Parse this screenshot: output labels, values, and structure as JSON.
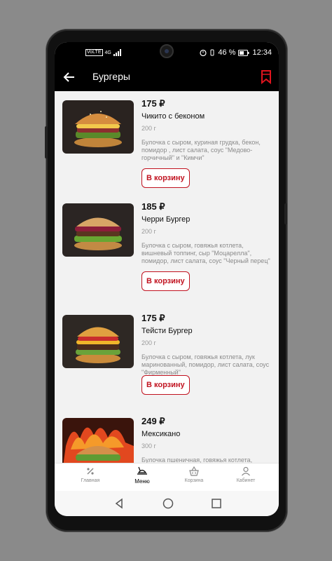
{
  "status_bar": {
    "network_badge": "VoLTE",
    "network_type": "4G",
    "battery_percent": "46 %",
    "time": "12:34"
  },
  "app_bar": {
    "title": "Бургеры",
    "back_icon": "arrow-left-icon",
    "bookmark_icon": "bookmark-icon"
  },
  "products": [
    {
      "price": "175 ₽",
      "name": "Чикито с беконом",
      "weight": "200 г",
      "description": "Булочка с сыром, куриная грудка, бекон, помидор , лист салата, соус \"Медово-горчичный\" и \"Кимчи\"",
      "button_label": "В корзину"
    },
    {
      "price": "185 ₽",
      "name": "Черри Бургер",
      "weight": "200 г",
      "description": "Булочка с сыром, говяжья котлета, вишневый топпинг, сыр \"Моцарелла\", помидор, лист салата, соус \"Черный перец\"",
      "button_label": "В корзину"
    },
    {
      "price": "175 ₽",
      "name": "Тейсти Бургер",
      "weight": "200 г",
      "description": "Булочка с сыром, говяжья котлета, лук маринованный, помидор, лист салата, соус \"Фирменный\"",
      "button_label": "В корзину"
    },
    {
      "price": "249 ₽",
      "name": "Мексикано",
      "weight": "300 г",
      "description": "Булочка пшеничная, говяжья котлета,"
    }
  ],
  "bottom_nav": [
    {
      "label": "Главная",
      "icon": "percent-icon",
      "active": false
    },
    {
      "label": "Меню",
      "icon": "menu-dish-icon",
      "active": true
    },
    {
      "label": "Корзина",
      "icon": "basket-icon",
      "active": false
    },
    {
      "label": "Кабинет",
      "icon": "user-icon",
      "active": false
    }
  ],
  "system_nav": [
    "back-triangle-icon",
    "home-circle-icon",
    "recents-square-icon"
  ],
  "colors": {
    "accent": "#c1121f",
    "app_bar_background": "#000000",
    "content_background": "#f2f2f2"
  }
}
